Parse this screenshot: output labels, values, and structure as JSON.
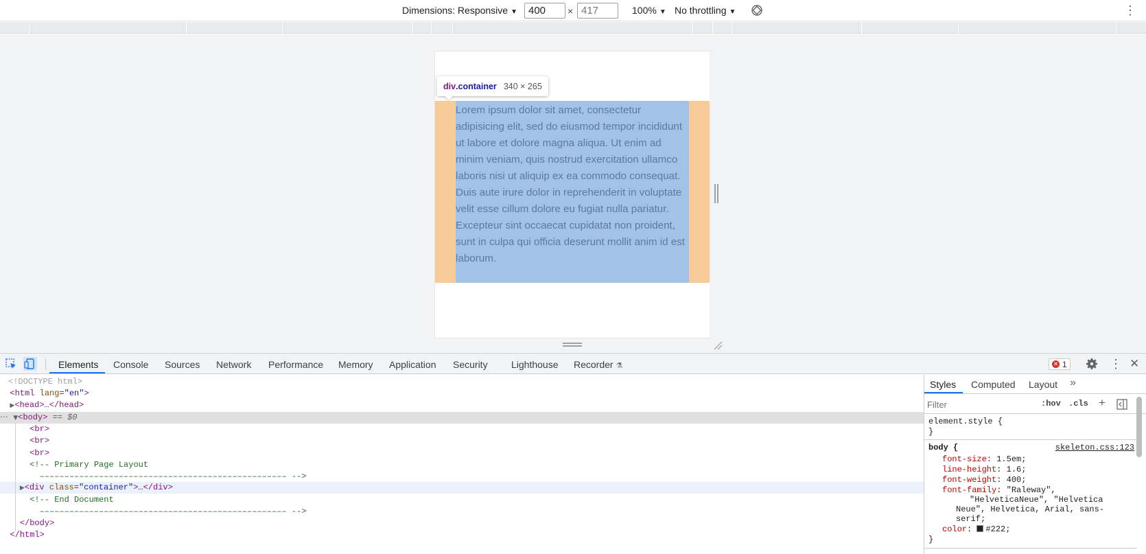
{
  "device_toolbar": {
    "dimensions_label": "Dimensions: Responsive",
    "width_value": "400",
    "height_value": "417",
    "times": "×",
    "zoom_label": "100%",
    "throttling_label": "No throttling"
  },
  "viewport": {
    "lorem": "Lorem ipsum dolor sit amet, consectetur adipisicing elit, sed do eiusmod tempor incididunt ut labore et dolore magna aliqua. Ut enim ad minim veniam, quis nostrud exercitation ullamco laboris nisi ut aliquip ex ea commodo consequat. Duis aute irure dolor in reprehenderit in voluptate velit esse cillum dolore eu fugiat nulla pariatur. Excepteur sint occaecat cupidatat non proident, sunt in culpa qui officia deserunt mollit anim id est laborum.",
    "tooltip_tag": "div",
    "tooltip_class": ".container",
    "tooltip_size": "340 × 265"
  },
  "devtools_tabs": [
    "Elements",
    "Console",
    "Sources",
    "Network",
    "Performance",
    "Memory",
    "Application",
    "Security",
    "Lighthouse",
    "Recorder"
  ],
  "error_count": "1",
  "dom": {
    "doctype": "<!DOCTYPE html>",
    "html_open_tag": "<html",
    "html_lang_attr": "lang",
    "html_lang_val": "\"en\"",
    "head": "<head>…</head>",
    "body_open": "<body>",
    "body_marker": "== $0",
    "br": "<br>",
    "comment1_line1": "<!-- Primary Page Layout",
    "comment1_line2": "–––––––––––––––––––––––––––––––––––––––––––––––––– -->",
    "div_open": "<div",
    "div_class_attr": "class",
    "div_class_val": "\"container\"",
    "div_rest": ">…</div>",
    "comment2_line1": "<!-- End Document",
    "comment2_line2": "–––––––––––––––––––––––––––––––––––––––––––––––––– -->",
    "body_close": "</body>",
    "html_close": "</html>"
  },
  "styles_pane": {
    "tabs": [
      "Styles",
      "Computed",
      "Layout"
    ],
    "filter_placeholder": "Filter",
    "hov": ":hov",
    "cls": ".cls",
    "element_style": "element.style {",
    "close_brace": "}",
    "body_selector": "body {",
    "source": "skeleton.css:123",
    "props": [
      {
        "name": "font-size",
        "value": "1.5em;"
      },
      {
        "name": "line-height",
        "value": "1.6;"
      },
      {
        "name": "font-weight",
        "value": "400;"
      }
    ],
    "font_family_name": "font-family",
    "font_family_value_1": "\"Raleway\",",
    "font_family_value_2": "\"HelveticaNeue\", \"Helvetica",
    "font_family_value_3": "Neue\", Helvetica, Arial, sans-",
    "font_family_value_4": "serif;",
    "color_name": "color",
    "color_value": "#222;"
  }
}
